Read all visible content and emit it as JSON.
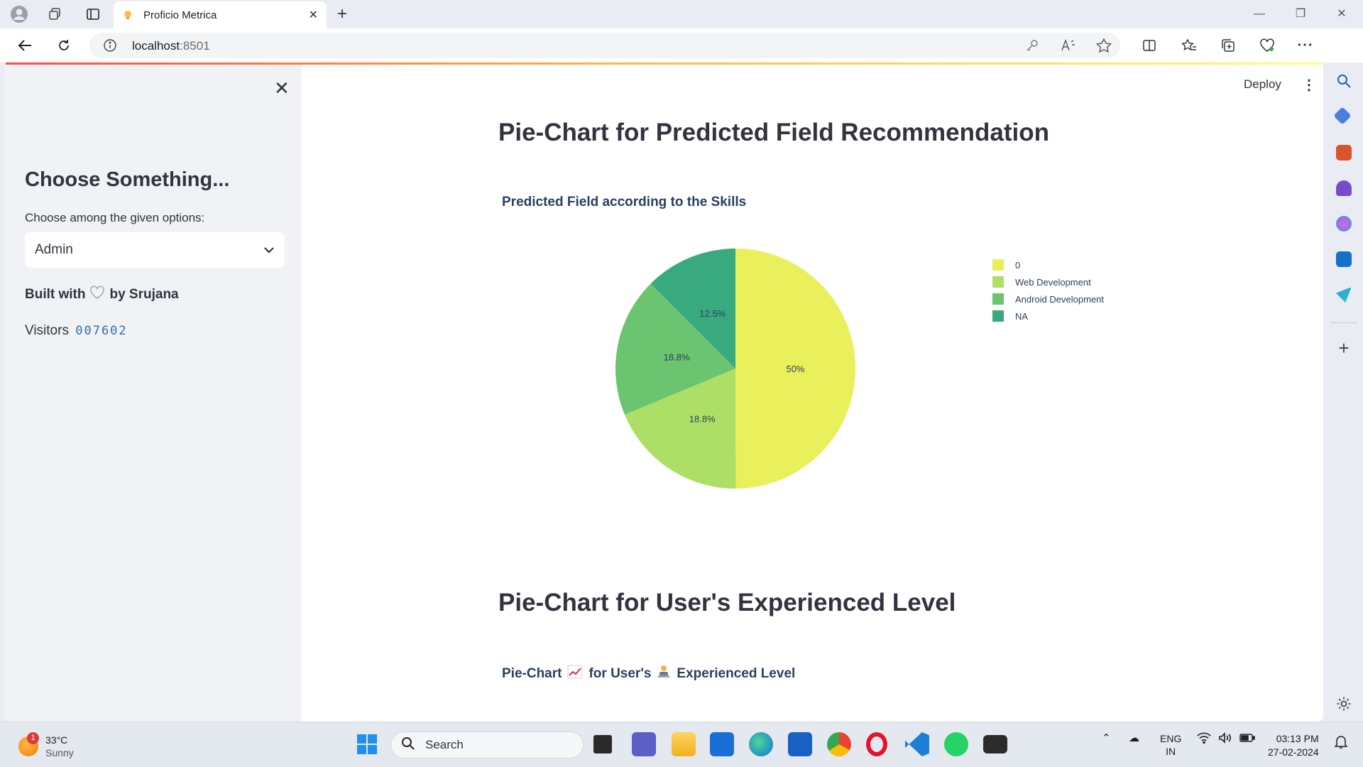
{
  "browser": {
    "tab_title": "Proficio Metrica",
    "url_host": "localhost",
    "url_port": ":8501"
  },
  "sidebar": {
    "heading": "Choose Something...",
    "select_label": "Choose among the given options:",
    "select_value": "Admin",
    "built_prefix": "Built with",
    "built_suffix": "by Srujana",
    "visitors_label": "Visitors",
    "visitors_count": "007602"
  },
  "header": {
    "deploy_label": "Deploy"
  },
  "main": {
    "section1_heading": "Pie-Chart for Predicted Field Recommendation",
    "chart1_title": "Predicted Field according to the Skills",
    "section2_heading": "Pie-Chart for User's Experienced Level",
    "chart2_title_part1": "Pie-Chart",
    "chart2_title_part2": "for User's",
    "chart2_title_part3": "Experienced Level"
  },
  "chart_data": {
    "type": "pie",
    "title": "Predicted Field according to the Skills",
    "categories": [
      "0",
      "Web Development",
      "Android Development",
      "NA"
    ],
    "values": [
      50,
      18.8,
      18.8,
      12.5
    ],
    "labels": [
      "50%",
      "18.8%",
      "18.8%",
      "12.5%"
    ],
    "colors": [
      "#eaef5c",
      "#addf66",
      "#6bc46f",
      "#39a97f"
    ],
    "legend_position": "right"
  },
  "taskbar": {
    "weather_temp": "33°C",
    "weather_cond": "Sunny",
    "weather_badge": "1",
    "search_label": "Search",
    "lang_top": "ENG",
    "lang_bottom": "IN",
    "time": "03:13 PM",
    "date": "27-02-2024"
  }
}
